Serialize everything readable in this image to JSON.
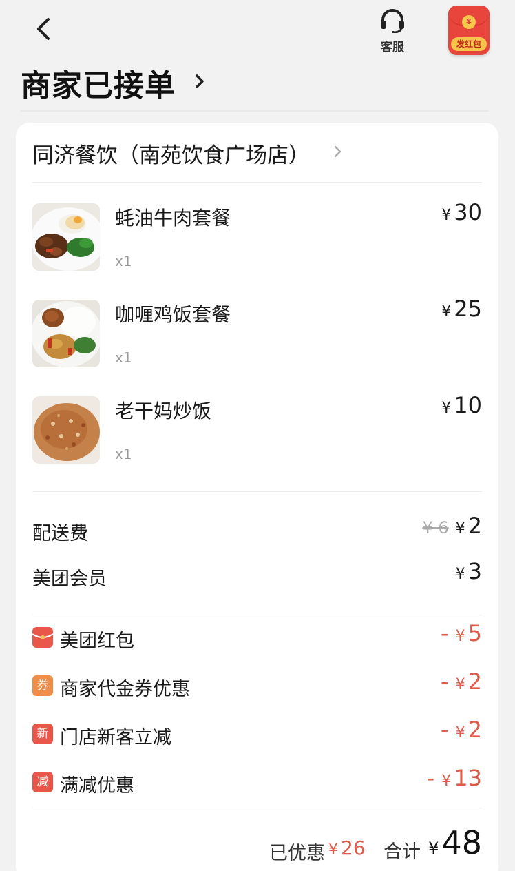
{
  "header": {
    "service_label": "客服",
    "redpacket_label": "发红包",
    "redpacket_coin": "¥"
  },
  "status": {
    "title": "商家已接单"
  },
  "shop": {
    "name": "同济餐饮（南苑饮食广场店）"
  },
  "currency": "¥",
  "items": [
    {
      "name": "蚝油牛肉套餐",
      "qty": "x1",
      "price": "30"
    },
    {
      "name": "咖喱鸡饭套餐",
      "qty": "x1",
      "price": "25"
    },
    {
      "name": "老干妈炒饭",
      "qty": "x1",
      "price": "10"
    }
  ],
  "fees": {
    "delivery_label": "配送费",
    "delivery_old": "¥ 6",
    "delivery_price": "2",
    "member_label": "美团会员",
    "member_price": "3"
  },
  "discounts": [
    {
      "icon": "redpacket-icon",
      "icon_text": "",
      "label": "美团红包",
      "prefix": "- ",
      "amount": "5",
      "color": "#e8574a"
    },
    {
      "icon": "coupon-icon",
      "icon_text": "券",
      "label": "商家代金券优惠",
      "prefix": "- ",
      "amount": "2",
      "color": "#ef8d4a"
    },
    {
      "icon": "new-customer-icon",
      "icon_text": "新",
      "label": "门店新客立减",
      "prefix": "- ",
      "amount": "2",
      "color": "#e8574a"
    },
    {
      "icon": "full-reduction-icon",
      "icon_text": "减",
      "label": "满减优惠",
      "prefix": "- ",
      "amount": "13",
      "color": "#e8574a"
    }
  ],
  "summary": {
    "saved_label": "已优惠",
    "saved_amount": "26",
    "total_label": "合计",
    "total_amount": "48"
  }
}
